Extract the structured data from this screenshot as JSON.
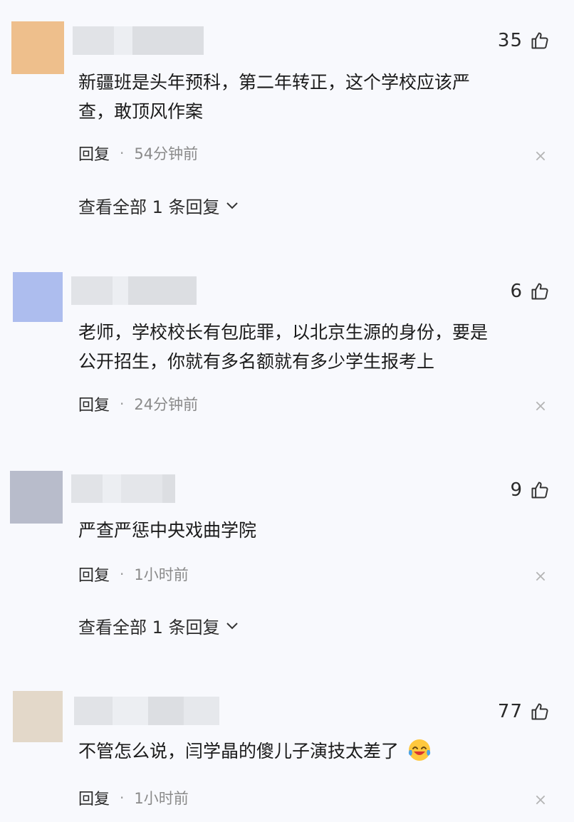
{
  "comments": [
    {
      "likes": "35",
      "text_lines": [
        "新疆班是头年预科，第二年转正，这个学校应该严",
        "查，敢顶风作案"
      ],
      "reply_label": "回复",
      "separator": "·",
      "time": "54分钟前",
      "view_replies": "查看全部 1 条回复",
      "avatar_color": "#eebf8c"
    },
    {
      "likes": "6",
      "text_lines": [
        "老师，学校校长有包庇罪，以北京生源的身份，要是",
        "公开招生，你就有多名额就有多少学生报考上"
      ],
      "reply_label": "回复",
      "separator": "·",
      "time": "24分钟前",
      "avatar_color": "#adbdee"
    },
    {
      "likes": "9",
      "text_lines": [
        "严查严惩中央戏曲学院"
      ],
      "reply_label": "回复",
      "separator": "·",
      "time": "1小时前",
      "view_replies": "查看全部 1 条回复",
      "avatar_color": "#b8bccb"
    },
    {
      "likes": "77",
      "text_lines": [
        "不管怎么说，闫学晶的傻儿子演技太差了"
      ],
      "emoji": "laughing-crying-emoji",
      "reply_label": "回复",
      "separator": "·",
      "time": "1小时前",
      "avatar_color": "#e3d8c9"
    }
  ]
}
